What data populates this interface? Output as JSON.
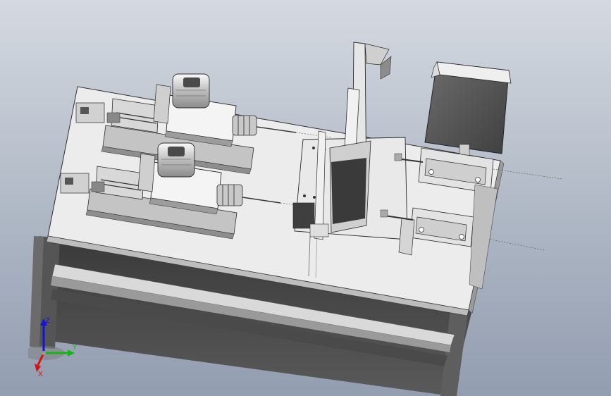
{
  "viewport": {
    "background_top": "#d4d9e1",
    "background_bottom": "#929db0"
  },
  "model": {
    "table_color": "#ececec",
    "frame_color": "#2e2e2e",
    "part_color": "#b9b9b9"
  },
  "triad": {
    "x_label": "X",
    "y_label": "Y",
    "z_label": "Z",
    "x_color": "#d11414",
    "y_color": "#15b515",
    "z_color": "#1515d1"
  }
}
